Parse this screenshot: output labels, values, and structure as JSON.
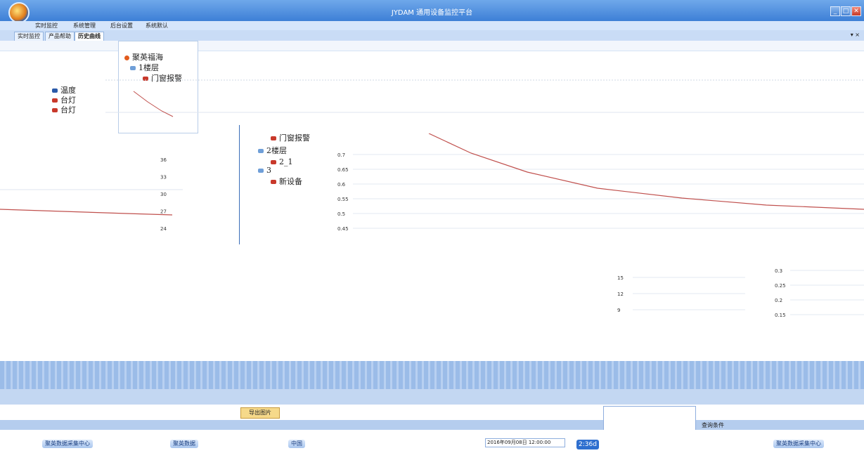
{
  "window": {
    "title": "JYDAM 通用设备监控平台",
    "minimize": "_",
    "maximize": "□",
    "close": "✕"
  },
  "menu": {
    "items": [
      "实时监控",
      "系统管理",
      "后台设置",
      "系统默认"
    ]
  },
  "tabs": {
    "items": [
      "实时监控",
      "产品帮助",
      "历史曲线"
    ],
    "active": 2,
    "controls": "▾ ×"
  },
  "tree": {
    "nodes": [
      "聚英福海",
      "1楼层",
      "门窗报警",
      "2楼层",
      "2_1",
      "3",
      "新设备"
    ],
    "left_nodes": [
      "温度",
      "台灯",
      "台灯"
    ]
  },
  "charts": {
    "left": {
      "ticks": [
        "36",
        "33",
        "30",
        "27",
        "24"
      ]
    },
    "right": {
      "ticks": [
        "0.7",
        "0.65",
        "0.6",
        "0.55",
        "0.5",
        "0.45"
      ]
    },
    "lower_mid": {
      "ticks": [
        "15",
        "12",
        "9"
      ]
    },
    "lower_right": {
      "ticks": [
        "0.3",
        "0.25",
        "0.2",
        "0.15"
      ]
    }
  },
  "buttons": {
    "export": "导出图片"
  },
  "query": {
    "label": "查询条件"
  },
  "taskbar": {
    "items": [
      "聚英数据采集中心",
      "聚英数据",
      "中国",
      "聚英数据采集中心"
    ],
    "time_badge": "2:36d",
    "date_field": "2016年09月08日 12:00:00"
  },
  "colors": {
    "accent": "#3d7fd6",
    "series": "#c0504d"
  }
}
